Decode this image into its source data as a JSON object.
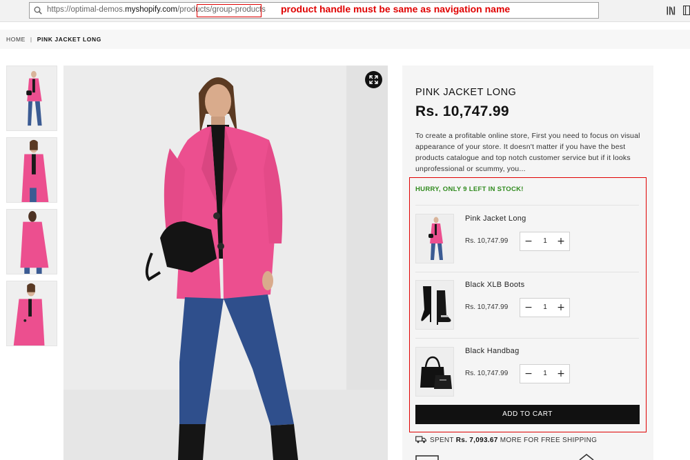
{
  "browser": {
    "url_prefix": "https://optimal-demos.",
    "url_host": "myshopify.com",
    "url_path": "/products/",
    "url_handle": "group-products",
    "annotation": "product handle must be same as navigation name"
  },
  "breadcrumb": {
    "home": "HOME",
    "separator": "|",
    "current": "PINK JACKET LONG"
  },
  "product": {
    "title": "PINK JACKET LONG",
    "price": "Rs. 10,747.99",
    "description": "To create a profitable online store, First you need to focus on visual appearance of your store. It doesn't matter if you have the best products catalogue and top notch customer service but if it looks unprofessional or scummy, you..."
  },
  "group": {
    "stock_message": "HURRY, ONLY 9 LEFT IN STOCK!",
    "items": [
      {
        "name": "Pink Jacket Long",
        "price": "Rs. 10,747.99",
        "minus": "−",
        "qty": "1",
        "plus": "+",
        "image_icon": "pink-jacket"
      },
      {
        "name": "Black XLB Boots",
        "price": "Rs. 10,747.99",
        "minus": "−",
        "qty": "1",
        "plus": "+",
        "image_icon": "black-boots"
      },
      {
        "name": "Black Handbag",
        "price": "Rs. 10,747.99",
        "minus": "−",
        "qty": "1",
        "plus": "+",
        "image_icon": "black-handbag"
      }
    ],
    "add_to_cart": "ADD TO CART"
  },
  "shipping": {
    "prefix": "SPENT",
    "amount": "Rs. 7,093.67",
    "suffix": "MORE FOR FREE SHIPPING"
  },
  "colors": {
    "annotation_red": "#e00000",
    "stock_green": "#2f8a1d",
    "jacket_pink": "#ec4f8f",
    "button_black": "#111111"
  }
}
